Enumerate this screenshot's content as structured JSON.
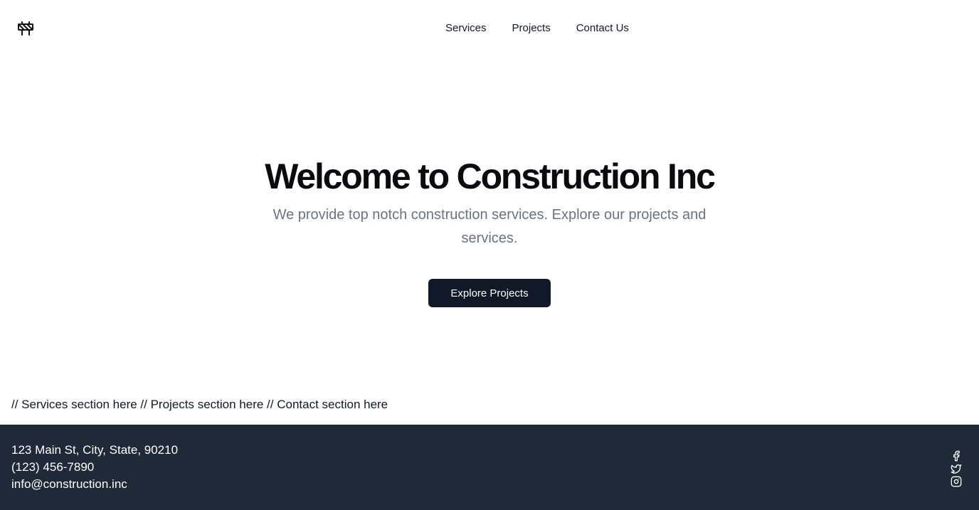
{
  "header": {
    "logo_icon": "construction-barrier-icon",
    "nav": [
      {
        "label": "Services"
      },
      {
        "label": "Projects"
      },
      {
        "label": "Contact Us"
      }
    ]
  },
  "hero": {
    "title": "Welcome to Construction Inc",
    "subtitle": "We provide top notch construction services. Explore our projects and services.",
    "cta_label": "Explore Projects"
  },
  "placeholder_text": "// Services section here // Projects section here // Contact section here",
  "footer": {
    "address": "123 Main St, City, State, 90210",
    "phone": "(123) 456-7890",
    "email": "info@construction.inc",
    "social_icons": [
      "facebook-icon",
      "twitter-icon",
      "instagram-icon"
    ]
  },
  "colors": {
    "primary_button": "#111827",
    "footer_bg": "#1f2937",
    "subtitle_text": "#6b7280"
  }
}
